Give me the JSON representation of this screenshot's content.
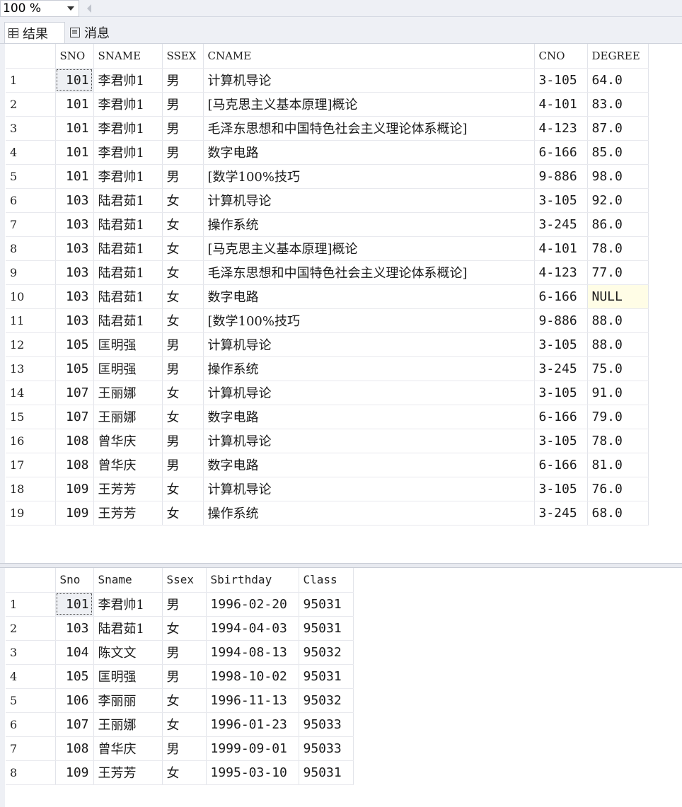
{
  "toolbar": {
    "zoom_value": "100 %"
  },
  "tabs": [
    {
      "label": "结果",
      "icon": "grid-icon"
    },
    {
      "label": "消息",
      "icon": "message-icon"
    }
  ],
  "result1": {
    "columns": [
      "",
      "SNO",
      "SNAME",
      "SSEX",
      "CNAME",
      "CNO",
      "DEGREE"
    ],
    "rows": [
      [
        "1",
        "101",
        "李君帅1",
        "男",
        "计算机导论",
        "3-105",
        "64.0"
      ],
      [
        "2",
        "101",
        "李君帅1",
        "男",
        "[马克思主义基本原理]概论",
        "4-101",
        "83.0"
      ],
      [
        "3",
        "101",
        "李君帅1",
        "男",
        "毛泽东思想和中国特色社会主义理论体系概论]",
        "4-123",
        "87.0"
      ],
      [
        "4",
        "101",
        "李君帅1",
        "男",
        "数字电路",
        "6-166",
        "85.0"
      ],
      [
        "5",
        "101",
        "李君帅1",
        "男",
        "[数学100%技巧",
        "9-886",
        "98.0"
      ],
      [
        "6",
        "103",
        "陆君茹1",
        "女",
        "计算机导论",
        "3-105",
        "92.0"
      ],
      [
        "7",
        "103",
        "陆君茹1",
        "女",
        "操作系统",
        "3-245",
        "86.0"
      ],
      [
        "8",
        "103",
        "陆君茹1",
        "女",
        "[马克思主义基本原理]概论",
        "4-101",
        "78.0"
      ],
      [
        "9",
        "103",
        "陆君茹1",
        "女",
        "毛泽东思想和中国特色社会主义理论体系概论]",
        "4-123",
        "77.0"
      ],
      [
        "10",
        "103",
        "陆君茹1",
        "女",
        "数字电路",
        "6-166",
        "NULL"
      ],
      [
        "11",
        "103",
        "陆君茹1",
        "女",
        "[数学100%技巧",
        "9-886",
        "88.0"
      ],
      [
        "12",
        "105",
        "匡明强",
        "男",
        "计算机导论",
        "3-105",
        "88.0"
      ],
      [
        "13",
        "105",
        "匡明强",
        "男",
        "操作系统",
        "3-245",
        "75.0"
      ],
      [
        "14",
        "107",
        "王丽娜",
        "女",
        "计算机导论",
        "3-105",
        "91.0"
      ],
      [
        "15",
        "107",
        "王丽娜",
        "女",
        "数字电路",
        "6-166",
        "79.0"
      ],
      [
        "16",
        "108",
        "曾华庆",
        "男",
        "计算机导论",
        "3-105",
        "78.0"
      ],
      [
        "17",
        "108",
        "曾华庆",
        "男",
        "数字电路",
        "6-166",
        "81.0"
      ],
      [
        "18",
        "109",
        "王芳芳",
        "女",
        "计算机导论",
        "3-105",
        "76.0"
      ],
      [
        "19",
        "109",
        "王芳芳",
        "女",
        "操作系统",
        "3-245",
        "68.0"
      ]
    ]
  },
  "result2": {
    "columns": [
      "",
      "Sno",
      "Sname",
      "Ssex",
      "Sbirthday",
      "Class"
    ],
    "rows": [
      [
        "1",
        "101",
        "李君帅1",
        "男",
        "1996-02-20",
        "95031"
      ],
      [
        "2",
        "103",
        "陆君茹1",
        "女",
        "1994-04-03",
        "95031"
      ],
      [
        "3",
        "104",
        "陈文文",
        "男",
        "1994-08-13",
        "95032"
      ],
      [
        "4",
        "105",
        "匡明强",
        "男",
        "1998-10-02",
        "95031"
      ],
      [
        "5",
        "106",
        "李丽丽",
        "女",
        "1996-11-13",
        "95032"
      ],
      [
        "6",
        "107",
        "王丽娜",
        "女",
        "1996-01-23",
        "95033"
      ],
      [
        "7",
        "108",
        "曾华庆",
        "男",
        "1999-09-01",
        "95033"
      ],
      [
        "8",
        "109",
        "王芳芳",
        "女",
        "1995-03-10",
        "95031"
      ]
    ]
  }
}
